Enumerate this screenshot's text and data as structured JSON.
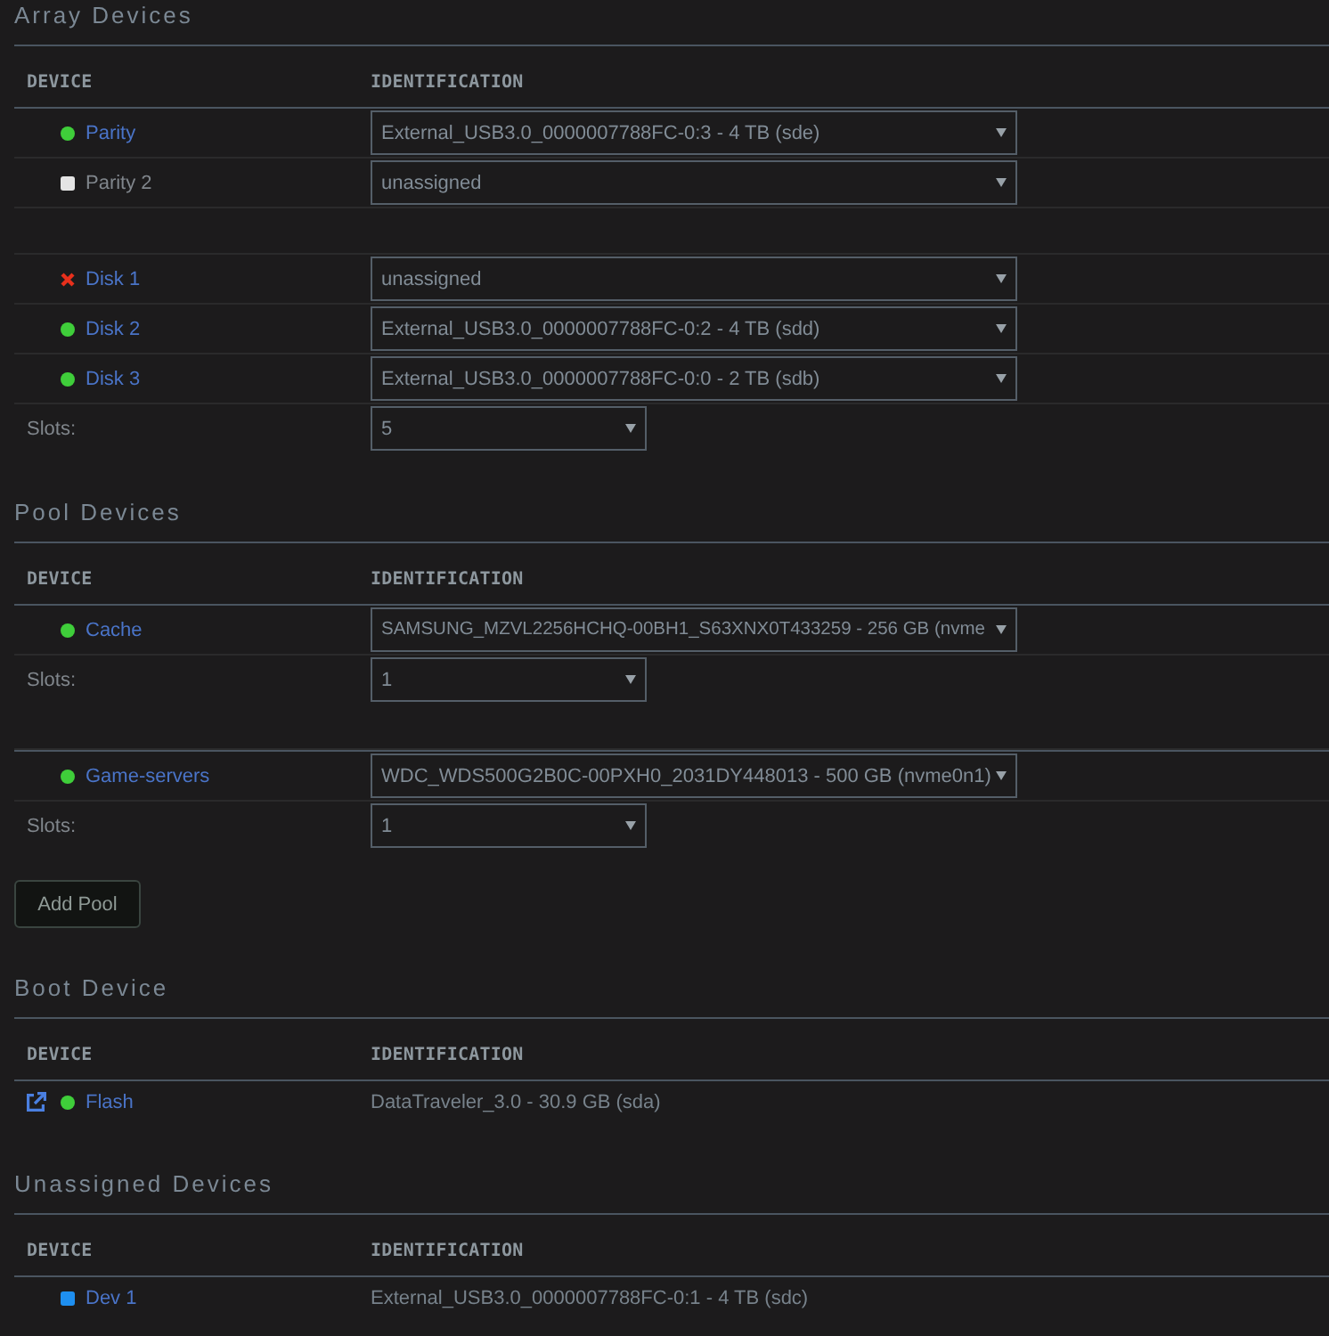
{
  "sections": [
    {
      "title": "Array Devices",
      "columns": [
        "DEVICE",
        "IDENTIFICATION"
      ],
      "rows": [
        {
          "kind": "device",
          "status": {
            "kind": "dot",
            "color": "#3fce3a"
          },
          "name": "Parity",
          "disabled": false,
          "external_link": false,
          "editable": true,
          "identification": "External_USB3.0_0000007788FC-0:3 - 4 TB (sde)"
        },
        {
          "kind": "device",
          "status": {
            "kind": "square",
            "color": "#e4e4e4"
          },
          "name": "Parity 2",
          "disabled": true,
          "external_link": false,
          "editable": true,
          "identification": "unassigned"
        },
        {
          "kind": "spacer"
        },
        {
          "kind": "device",
          "status": {
            "kind": "cross",
            "color": "#e8301c"
          },
          "name": "Disk 1",
          "disabled": false,
          "external_link": false,
          "editable": true,
          "identification": "unassigned"
        },
        {
          "kind": "device",
          "status": {
            "kind": "dot",
            "color": "#3fce3a"
          },
          "name": "Disk 2",
          "disabled": false,
          "external_link": false,
          "editable": true,
          "identification": "External_USB3.0_0000007788FC-0:2 - 4 TB (sdd)"
        },
        {
          "kind": "device",
          "status": {
            "kind": "dot",
            "color": "#3fce3a"
          },
          "name": "Disk 3",
          "disabled": false,
          "external_link": false,
          "editable": true,
          "identification": "External_USB3.0_0000007788FC-0:0 - 2 TB (sdb)"
        },
        {
          "kind": "slots",
          "label": "Slots:",
          "value": "5"
        }
      ]
    },
    {
      "title": "Pool Devices",
      "columns": [
        "DEVICE",
        "IDENTIFICATION"
      ],
      "rows": [
        {
          "kind": "device",
          "status": {
            "kind": "dot",
            "color": "#3fce3a"
          },
          "name": "Cache",
          "disabled": false,
          "external_link": false,
          "editable": true,
          "identification": "SAMSUNG_MZVL2256HCHQ-00BH1_S63XNX0T433259 - 256 GB (nvme"
        },
        {
          "kind": "slots",
          "label": "Slots:",
          "value": "1"
        },
        {
          "kind": "spacer"
        },
        {
          "kind": "divider"
        },
        {
          "kind": "device",
          "status": {
            "kind": "dot",
            "color": "#3fce3a"
          },
          "name": "Game-servers",
          "disabled": false,
          "external_link": false,
          "editable": true,
          "identification": "WDC_WDS500G2B0C-00PXH0_2031DY448013 - 500 GB (nvme0n1)"
        },
        {
          "kind": "slots",
          "label": "Slots:",
          "value": "1"
        }
      ],
      "button": "Add Pool"
    },
    {
      "title": "Boot Device",
      "columns": [
        "DEVICE",
        "IDENTIFICATION"
      ],
      "rows": [
        {
          "kind": "device",
          "status": {
            "kind": "dot",
            "color": "#3fce3a"
          },
          "name": "Flash",
          "disabled": false,
          "external_link": true,
          "editable": false,
          "identification": "DataTraveler_3.0 - 30.9 GB (sda)"
        }
      ]
    },
    {
      "title": "Unassigned Devices",
      "columns": [
        "DEVICE",
        "IDENTIFICATION"
      ],
      "rows": [
        {
          "kind": "device",
          "status": {
            "kind": "square",
            "color": "#1e8ff0"
          },
          "name": "Dev 1",
          "disabled": false,
          "external_link": false,
          "editable": false,
          "identification": "External_USB3.0_0000007788FC-0:1 - 4 TB (sdc)"
        }
      ]
    }
  ]
}
